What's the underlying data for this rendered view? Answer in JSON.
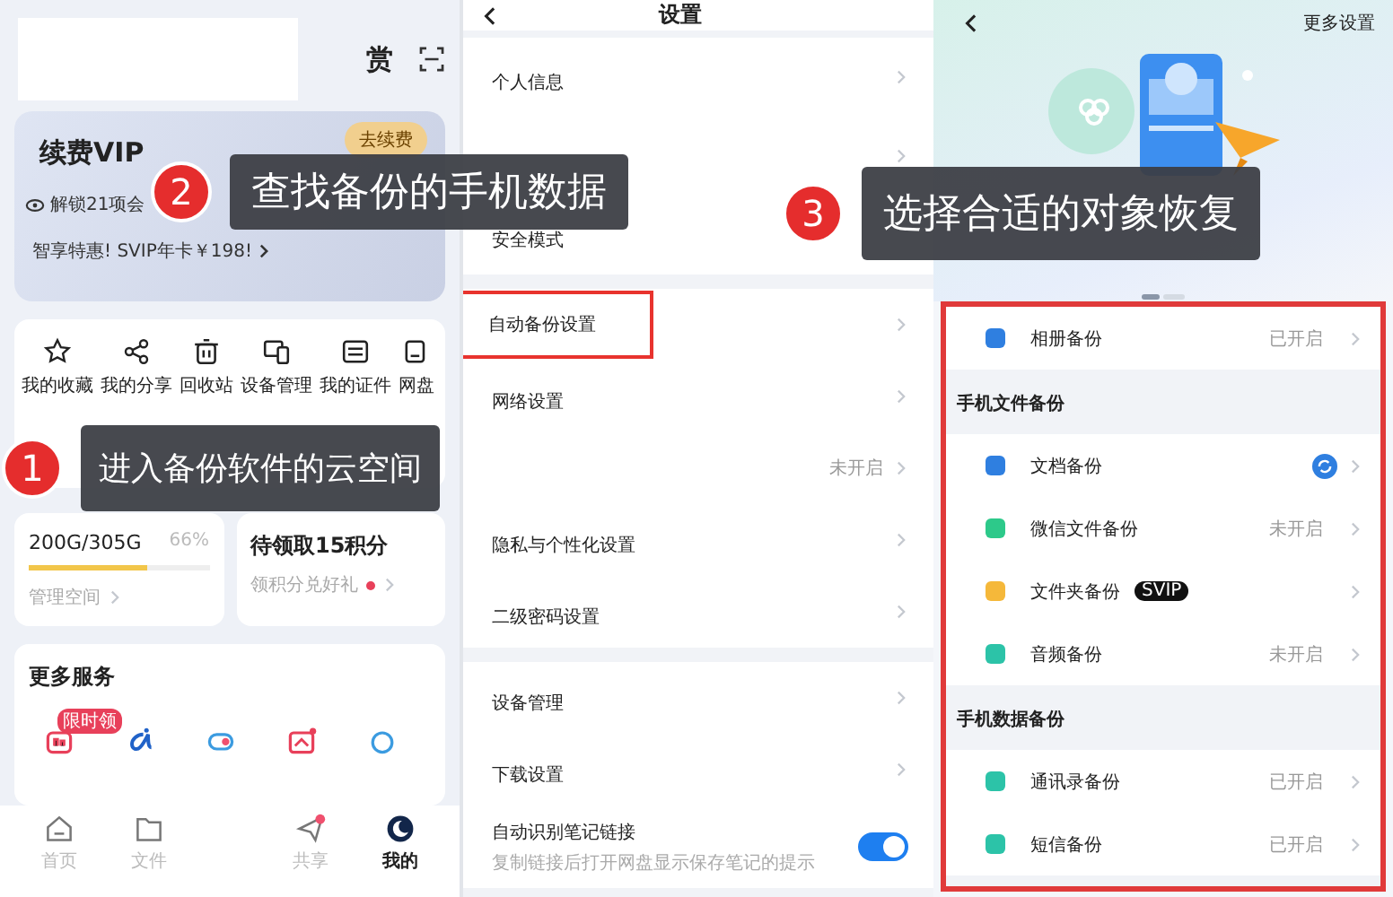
{
  "left_screen": {
    "top_icon_text": "赏",
    "vip_card": {
      "title": "续费VIP",
      "button": "去续费",
      "benefit": "解锁21项会",
      "promo": "智享特惠! SVIP年卡￥198!"
    },
    "shortcuts": [
      "我的收藏",
      "我的分享",
      "回收站",
      "设备管理",
      "我的证件",
      "网盘"
    ],
    "storage": {
      "usage": "200G/305G",
      "percent": "66%",
      "level": 0.66,
      "link": "管理空间"
    },
    "points": {
      "title": "待领取15积分",
      "link": "领积分兑好礼"
    },
    "more_services": {
      "title": "更多服务",
      "badge": "限时领"
    },
    "tab_bar": [
      {
        "label": "首页",
        "selected": false
      },
      {
        "label": "文件",
        "selected": false
      },
      {
        "label": "共享",
        "selected": false
      },
      {
        "label": "我的",
        "selected": true
      }
    ]
  },
  "middle_screen": {
    "title": "设置",
    "groups": [
      [
        {
          "kind": "row",
          "label": "个人信息"
        },
        {
          "kind": "row"
        },
        {
          "kind": "row",
          "label": "安全模式",
          "chevron_hidden": true
        }
      ],
      [
        {
          "kind": "row",
          "label": "自动备份设置",
          "highlighted": true
        },
        {
          "kind": "row",
          "label": "网络设置"
        },
        {
          "kind": "row",
          "status": "未开启"
        },
        {
          "kind": "row",
          "label": "隐私与个性化设置"
        },
        {
          "kind": "row",
          "label": "二级密码设置"
        }
      ],
      [
        {
          "kind": "row",
          "label": "设备管理"
        },
        {
          "kind": "row",
          "label": "下载设置"
        },
        {
          "kind": "toggle",
          "label": "自动识别笔记链接",
          "subtitle": "复制链接后打开网盘显示保存笔记的提示",
          "on": true
        }
      ]
    ]
  },
  "right_screen": {
    "more_settings": "更多设置",
    "list_highlighted": true,
    "rows": [
      {
        "kind": "row",
        "label": "相册备份",
        "status": "已开启",
        "color": "#2f7fe0"
      },
      {
        "kind": "section",
        "label": "手机文件备份"
      },
      {
        "kind": "row",
        "label": "文档备份",
        "syncing": true,
        "color": "#2f7fe0"
      },
      {
        "kind": "row",
        "label": "微信文件备份",
        "status": "未开启",
        "color": "#2dc98a"
      },
      {
        "kind": "row",
        "label": "文件夹备份",
        "badge": "SVIP",
        "color": "#f5b83a"
      },
      {
        "kind": "row",
        "label": "音频备份",
        "status": "未开启",
        "color": "#2cc3a8"
      },
      {
        "kind": "section",
        "label": "手机数据备份"
      },
      {
        "kind": "row",
        "label": "通讯录备份",
        "status": "已开启",
        "color": "#2cc3a8"
      },
      {
        "kind": "row",
        "label": "短信备份",
        "status": "已开启",
        "color": "#2cc3a8"
      }
    ]
  },
  "callouts": [
    {
      "number": "2",
      "text": "查找备份的手机数据"
    },
    {
      "number": "3",
      "text": "选择合适的对象恢复"
    },
    {
      "number": "1",
      "text": "进入备份软件的云空间"
    }
  ]
}
